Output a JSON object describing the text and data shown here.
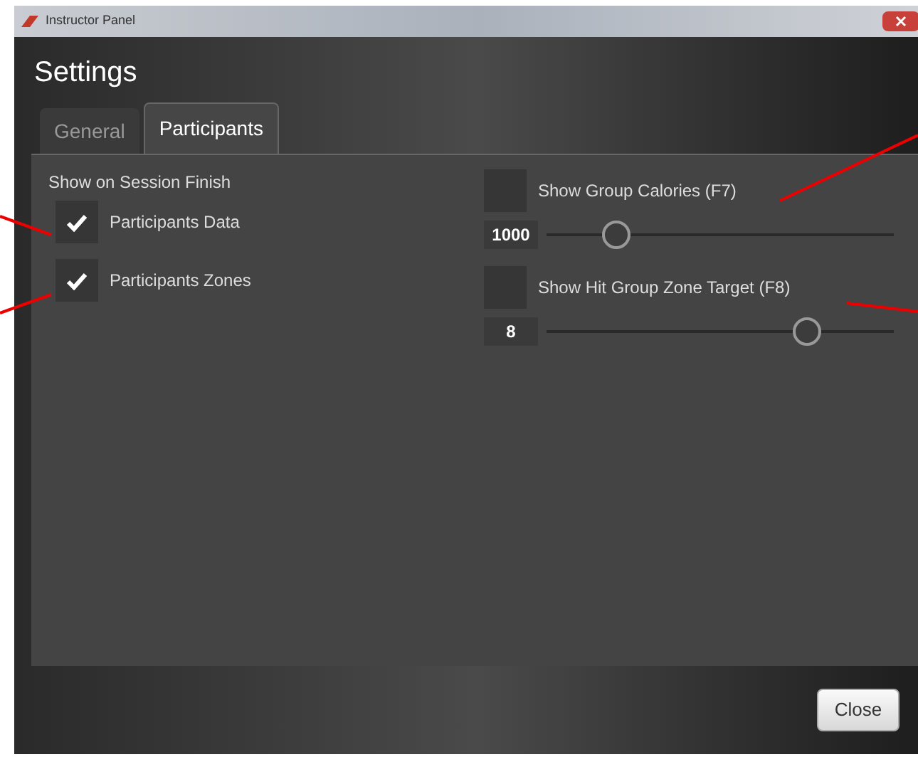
{
  "window": {
    "title": "Instructor Panel"
  },
  "header": {
    "title": "Settings"
  },
  "tabs": [
    {
      "label": "General",
      "selected": false
    },
    {
      "label": "Participants",
      "selected": true
    }
  ],
  "left": {
    "heading": "Show on Session Finish",
    "checkboxes": [
      {
        "label": "Participants Data",
        "checked": true
      },
      {
        "label": "Participants Zones",
        "checked": true
      }
    ]
  },
  "right": [
    {
      "label": "Show Group Calories (F7)",
      "checked": false,
      "value": "1000",
      "level": 0.2
    },
    {
      "label": "Show Hit Group Zone Target (F8)",
      "checked": false,
      "value": "8",
      "level": 0.75
    }
  ],
  "buttons": [
    "Close"
  ]
}
